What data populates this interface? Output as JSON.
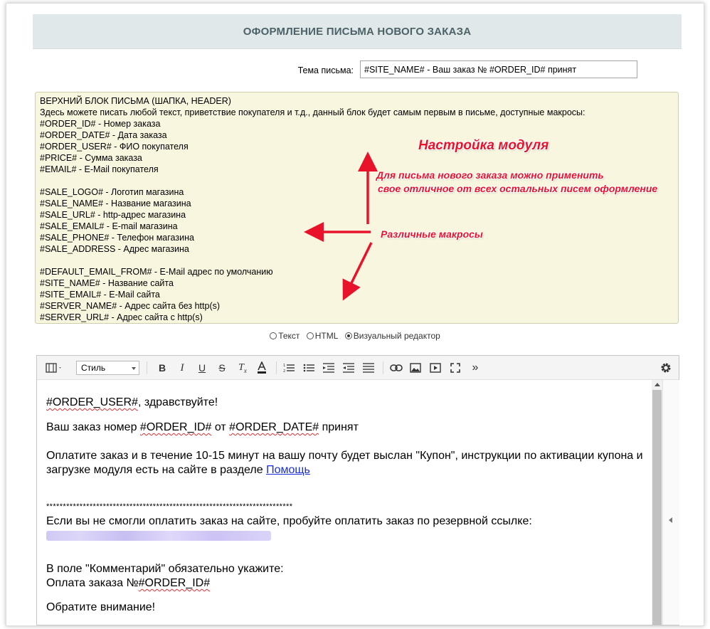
{
  "header": {
    "title": "ОФОРМЛЕНИЕ ПИСЬМА НОВОГО ЗАКАЗА"
  },
  "subject": {
    "label": "Тема письма:",
    "value": "#SITE_NAME# - Ваш заказ № #ORDER_ID# принят"
  },
  "macros_box": {
    "lines": [
      "ВЕРХНИЙ БЛОК ПИСЬМА (ШАПКА, HEADER)",
      "Здесь можете писать любой текст, приветствие покупателя и т.д., данный блок будет самым первым в письме, доступные макросы:",
      "#ORDER_ID# - Номер заказа",
      "#ORDER_DATE# - Дата заказа",
      "#ORDER_USER# - ФИО покупателя",
      "#PRICE# - Сумма заказа",
      "#EMAIL# - E-Mail покупателя",
      "",
      "#SALE_LOGO# - Логотип магазина",
      "#SALE_NAME# - Название магазина",
      "#SALE_URL# - http-адрес магазина",
      "#SALE_EMAIL# - E-mail магазина",
      "#SALE_PHONE# - Телефон магазина",
      "#SALE_ADDRESS - Адрес магазина",
      "",
      "#DEFAULT_EMAIL_FROM# - E-Mail адрес по умолчанию",
      "#SITE_NAME# - Название сайта",
      "#SITE_EMAIL# - E-Mail сайта",
      "#SERVER_NAME# - Адрес сайта без http(s)",
      "#SERVER_URL# - Адрес сайта с http(s)"
    ]
  },
  "annotations": {
    "title": "Настройка модуля",
    "desc_line1": "Для письма нового заказа можно применить",
    "desc_line2": "свое отличное от всех остальных писем оформление",
    "macros": "Различные макросы",
    "color": "#e8132b"
  },
  "editor_mode": {
    "options": [
      "Текст",
      "HTML",
      "Визуальный редактор"
    ],
    "selected": "Визуальный редактор"
  },
  "toolbar": {
    "style_label": "Стиль",
    "icons": [
      "layout-icon",
      "bold-icon",
      "italic-icon",
      "underline-icon",
      "strikethrough-icon",
      "clear-format-icon",
      "text-color-icon",
      "ordered-list-icon",
      "unordered-list-icon",
      "outdent-icon",
      "indent-icon",
      "justify-icon",
      "link-icon",
      "image-icon",
      "video-icon",
      "fullscreen-icon",
      "more-icon",
      "settings-icon"
    ]
  },
  "editor_content": {
    "greeting_var": "#ORDER_USER#",
    "greeting_rest": ", здравствуйте!",
    "order_pre": "Ваш заказ номер ",
    "order_id": "#ORDER_ID#",
    "order_mid": " от ",
    "order_date": "#ORDER_DATE#",
    "order_post": " принят",
    "pay_line1": "Оплатите заказ и в течение 10-15 минут на вашу почту будет выслан \"Купон\", инструкции по активации купона и",
    "pay_line2": "загрузке модуля есть на сайте в разделе ",
    "help_link": "Помощь",
    "stars": "**************************************************************************",
    "backup_text": "Если вы не смогли оплатить заказ на сайте, пробуйте оплатить заказ по резервной ссылке:",
    "comment_text": "В поле \"Комментарий\" обязательно укажите:",
    "payment_pre": "Оплата заказа №",
    "payment_id": "#ORDER_ID#",
    "attention": "Обратите внимание!"
  }
}
